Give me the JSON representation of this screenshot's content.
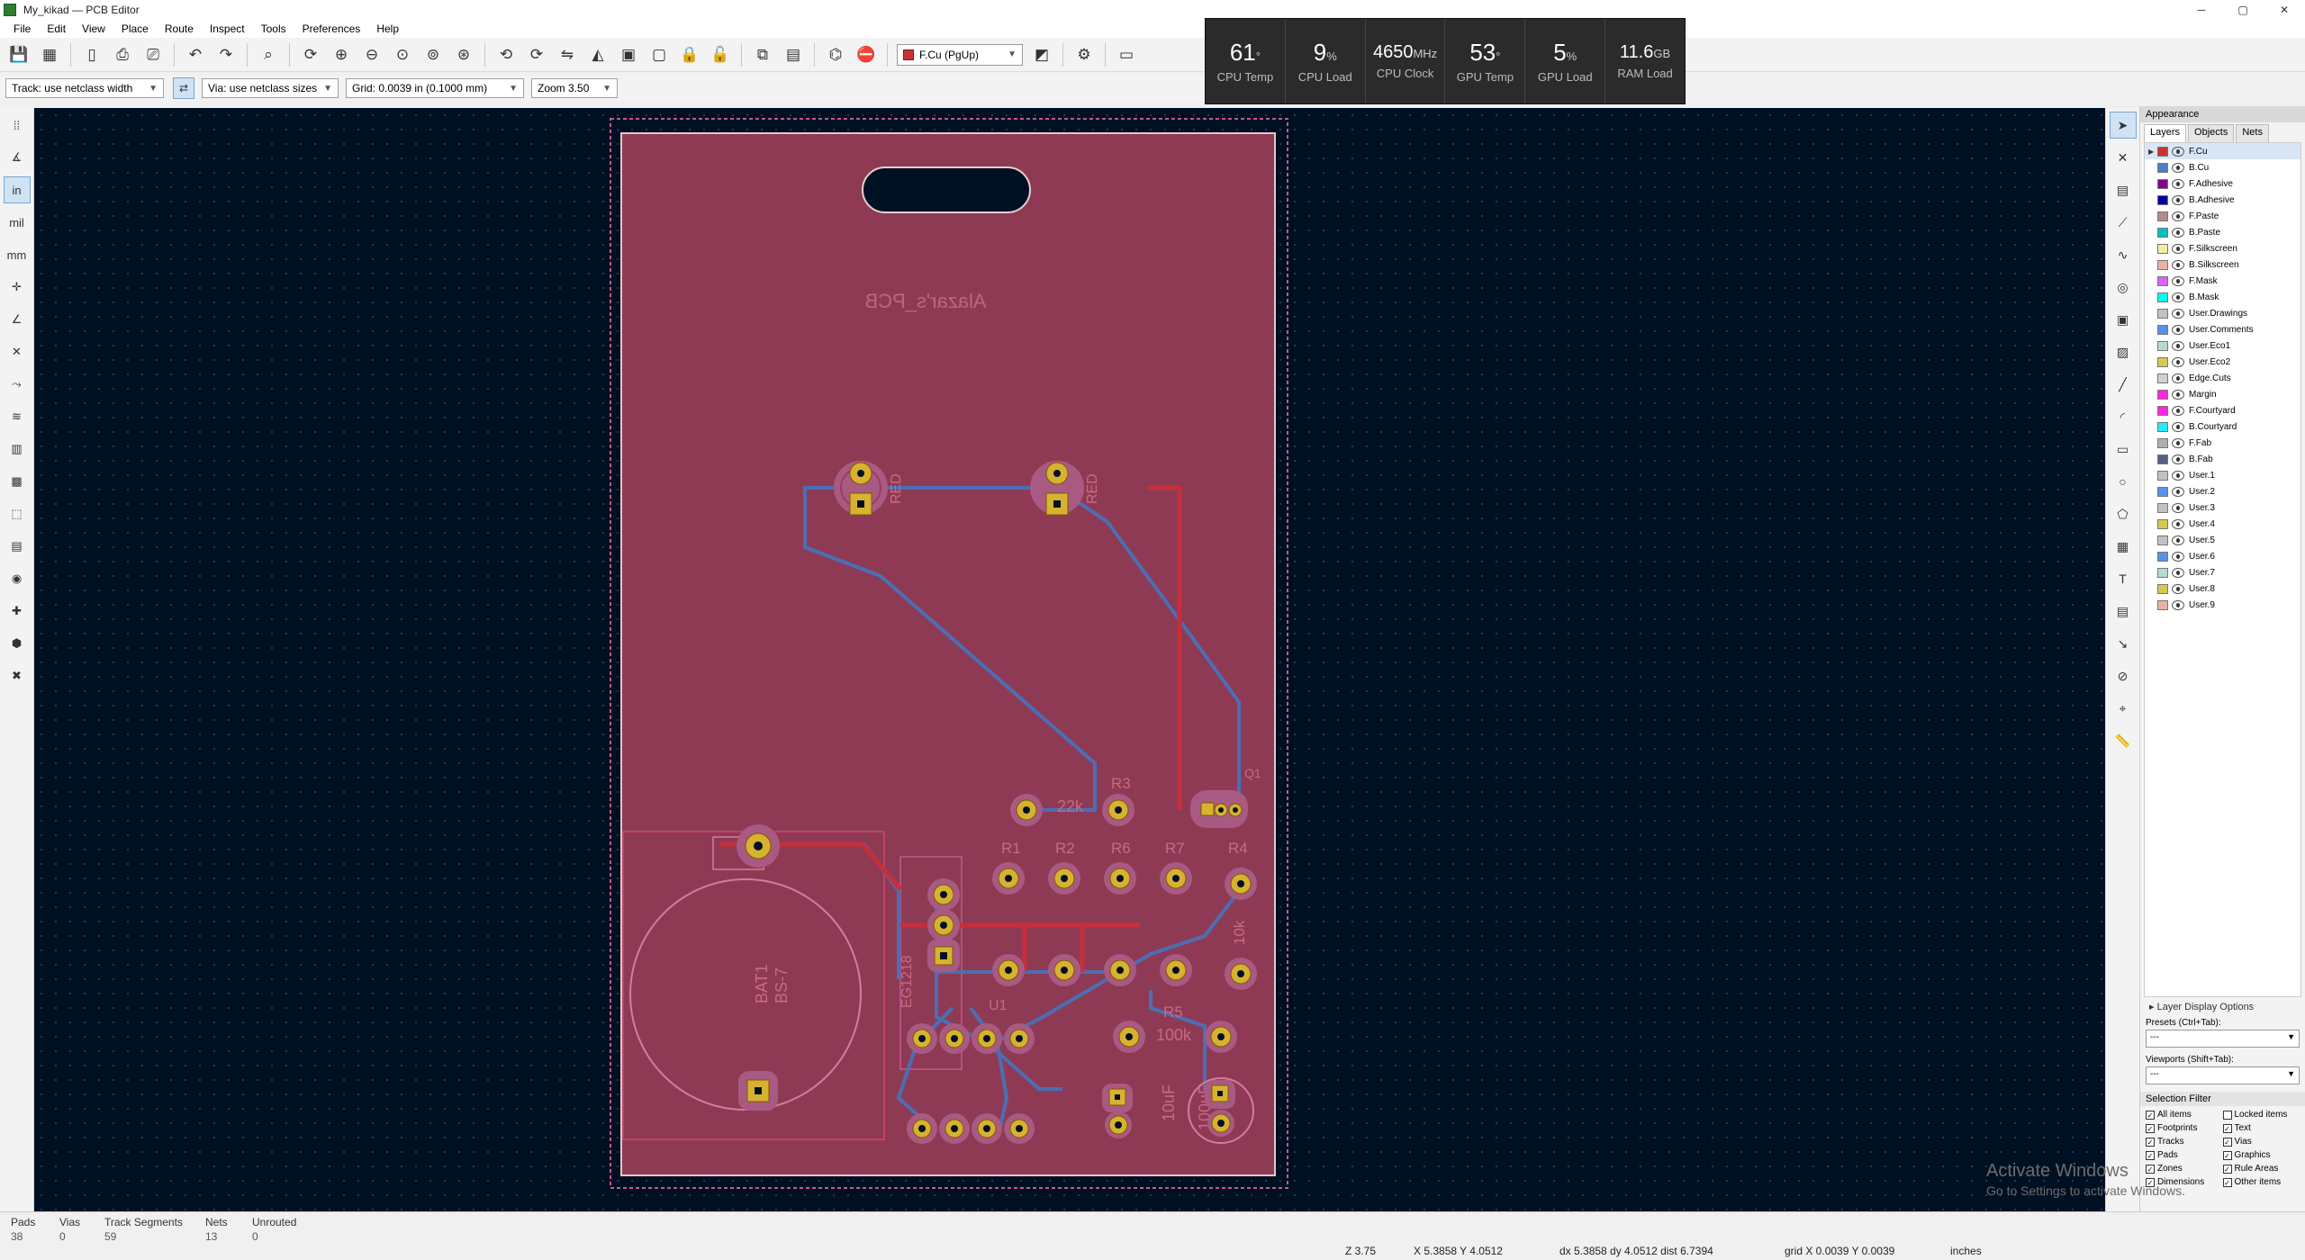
{
  "window": {
    "title": "My_kikad — PCB Editor",
    "controls": [
      "─",
      "▢",
      "✕"
    ]
  },
  "menu": [
    "File",
    "Edit",
    "View",
    "Place",
    "Route",
    "Inspect",
    "Tools",
    "Preferences",
    "Help"
  ],
  "toolbar": {
    "layer_select": "F.Cu (PgUp)",
    "track_width": "Track: use netclass width",
    "via_size": "Via: use netclass sizes",
    "grid": "Grid: 0.0039 in (0.1000 mm)",
    "zoom": "Zoom 3.50"
  },
  "stats": [
    {
      "value": "61",
      "unit": "°",
      "label": "CPU Temp"
    },
    {
      "value": "9",
      "unit": "%",
      "label": "CPU Load"
    },
    {
      "value": "4650",
      "unit": "MHz",
      "label": "CPU Clock"
    },
    {
      "value": "53",
      "unit": "°",
      "label": "GPU Temp"
    },
    {
      "value": "5",
      "unit": "%",
      "label": "GPU Load"
    },
    {
      "value": "11.6",
      "unit": "GB",
      "label": "RAM Load"
    }
  ],
  "left_toolbar": {
    "inch": "in",
    "mil": "mil",
    "mm": "mm"
  },
  "pcb": {
    "board_text": "Alazar's_PCB",
    "led_label_1": "RED",
    "led_label_2": "RED",
    "r1": "R1",
    "r2": "R2",
    "r3": "R3",
    "r4": "R4",
    "r5": "R5",
    "r6": "R6",
    "r7": "R7",
    "val_22k": "22k",
    "val_100k": "100k",
    "val_10k": "10k",
    "val_10uf": "10uF",
    "val_100uf": "100uF",
    "bat_ref": "BAT1",
    "bat_val": "BS-7",
    "ic_label": "EG1218",
    "u1": "U1",
    "q1": "Q1"
  },
  "appearance": {
    "title": "Appearance",
    "tabs": [
      "Layers",
      "Objects",
      "Nets"
    ],
    "layers": [
      {
        "name": "F.Cu",
        "color": "#c83434"
      },
      {
        "name": "B.Cu",
        "color": "#4d7fc4"
      },
      {
        "name": "F.Adhesive",
        "color": "#84008a"
      },
      {
        "name": "B.Adhesive",
        "color": "#0000a0"
      },
      {
        "name": "F.Paste",
        "color": "#b48c8c"
      },
      {
        "name": "B.Paste",
        "color": "#00c2c2"
      },
      {
        "name": "F.Silkscreen",
        "color": "#f2eda1"
      },
      {
        "name": "B.Silkscreen",
        "color": "#e8b2a7"
      },
      {
        "name": "F.Mask",
        "color": "#d864ff"
      },
      {
        "name": "B.Mask",
        "color": "#02ffee"
      },
      {
        "name": "User.Drawings",
        "color": "#c2c2c2"
      },
      {
        "name": "User.Comments",
        "color": "#5991e6"
      },
      {
        "name": "User.Eco1",
        "color": "#b4dbd2"
      },
      {
        "name": "User.Eco2",
        "color": "#d8c852"
      },
      {
        "name": "Edge.Cuts",
        "color": "#d0d2cd"
      },
      {
        "name": "Margin",
        "color": "#ff26e2"
      },
      {
        "name": "F.Courtyard",
        "color": "#ff26e2"
      },
      {
        "name": "B.Courtyard",
        "color": "#26e9ff"
      },
      {
        "name": "F.Fab",
        "color": "#afafaf"
      },
      {
        "name": "B.Fab",
        "color": "#585d84"
      },
      {
        "name": "User.1",
        "color": "#c2c2c2"
      },
      {
        "name": "User.2",
        "color": "#5991e6"
      },
      {
        "name": "User.3",
        "color": "#c2c2c2"
      },
      {
        "name": "User.4",
        "color": "#d8c852"
      },
      {
        "name": "User.5",
        "color": "#c2c2c2"
      },
      {
        "name": "User.6",
        "color": "#5991e6"
      },
      {
        "name": "User.7",
        "color": "#b4dbd2"
      },
      {
        "name": "User.8",
        "color": "#d8c852"
      },
      {
        "name": "User.9",
        "color": "#e8b2a7"
      }
    ],
    "layer_display_options": "Layer Display Options",
    "presets_label": "Presets (Ctrl+Tab):",
    "presets_value": "---",
    "viewports_label": "Viewports (Shift+Tab):",
    "viewports_value": "---"
  },
  "selection_filter": {
    "title": "Selection Filter",
    "items": [
      {
        "label": "All items",
        "checked": true
      },
      {
        "label": "Locked items",
        "checked": false
      },
      {
        "label": "Footprints",
        "checked": true
      },
      {
        "label": "Text",
        "checked": true
      },
      {
        "label": "Tracks",
        "checked": true
      },
      {
        "label": "Vias",
        "checked": true
      },
      {
        "label": "Pads",
        "checked": true
      },
      {
        "label": "Graphics",
        "checked": true
      },
      {
        "label": "Zones",
        "checked": true
      },
      {
        "label": "Rule Areas",
        "checked": true
      },
      {
        "label": "Dimensions",
        "checked": true
      },
      {
        "label": "Other items",
        "checked": true
      }
    ]
  },
  "status": {
    "pads_label": "Pads",
    "pads": "38",
    "vias_label": "Vias",
    "vias": "0",
    "tracks_label": "Track Segments",
    "tracks": "59",
    "nets_label": "Nets",
    "nets": "13",
    "unrouted_label": "Unrouted",
    "unrouted": "0",
    "zoom": "Z 3.75",
    "coords": "X 5.3858  Y 4.0512",
    "delta": "dx 5.3858  dy 4.0512  dist 6.7394",
    "grid": "grid X 0.0039  Y 0.0039",
    "units": "inches"
  },
  "watermark": {
    "line1": "Activate Windows",
    "line2": "Go to Settings to activate Windows."
  }
}
